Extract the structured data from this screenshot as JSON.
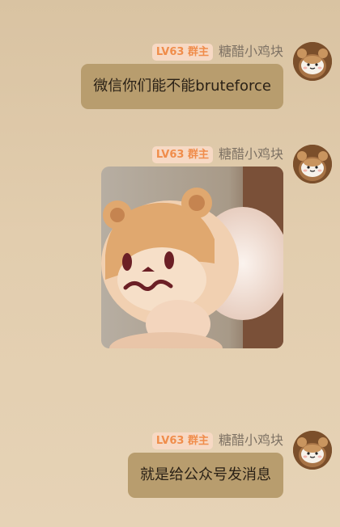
{
  "chat": {
    "messages": [
      {
        "badge": "LV63 群主",
        "sender": "糖醋小鸡块",
        "text": "微信你们能不能bruteforce",
        "avatar_icon": "hamster-avatar-icon"
      },
      {
        "badge": "LV63 群主",
        "sender": "糖醋小鸡块",
        "image": "bear-plush-sticker",
        "avatar_icon": "hamster-avatar-icon"
      },
      {
        "badge": "LV63 群主",
        "sender": "糖醋小鸡块",
        "text": "就是给公众号发消息",
        "avatar_icon": "hamster-avatar-icon"
      }
    ]
  },
  "colors": {
    "background": "#dec9a9",
    "bubble": "#b89d6e",
    "badge_bg": "#f7d9c4",
    "badge_text": "#f08d4b",
    "nickname": "#7e7264"
  }
}
